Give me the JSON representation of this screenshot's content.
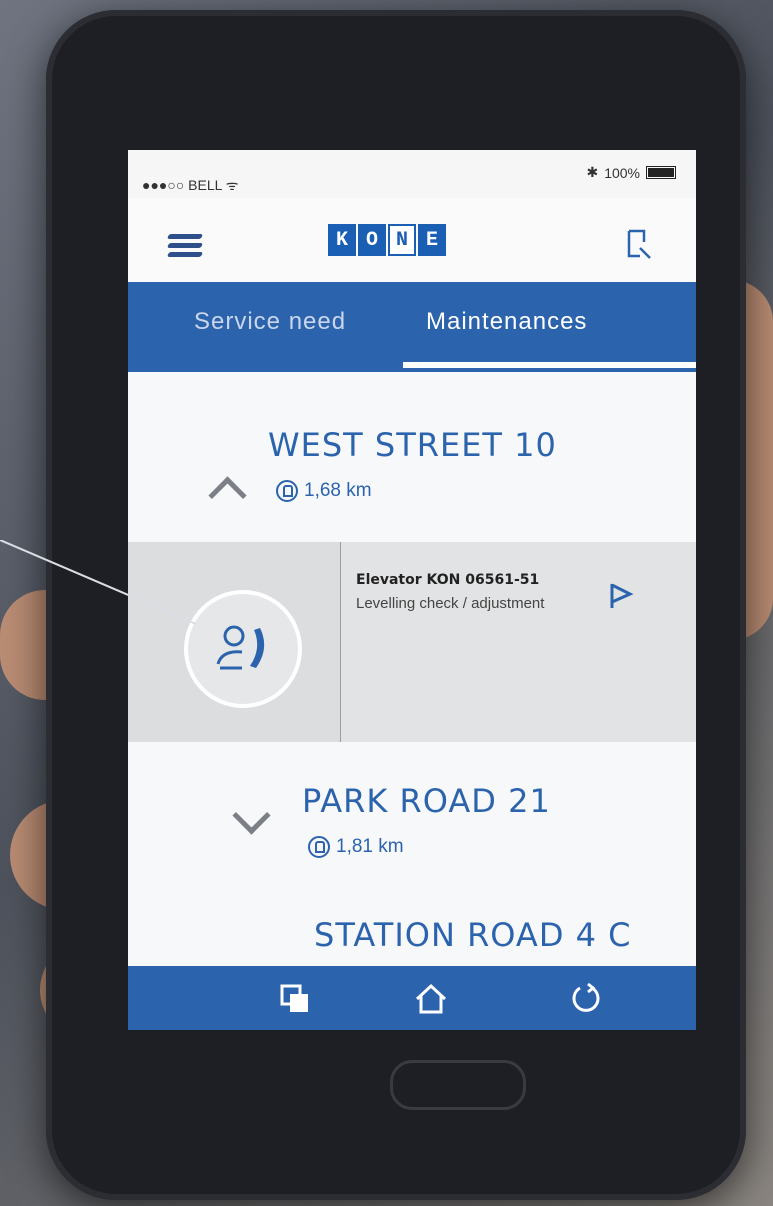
{
  "status_bar": {
    "carrier": "●●●○○ BELL ᯤ",
    "battery": "100%"
  },
  "header": {
    "logo_letters": [
      "K",
      "O",
      "N",
      "E"
    ]
  },
  "tabs": [
    {
      "label": "Service need",
      "active": false
    },
    {
      "label": "Maintenances",
      "active": true
    }
  ],
  "locations": [
    {
      "name": "WEST STREET 10",
      "distance": "1,68 km",
      "expanded": true
    },
    {
      "name": "PARK ROAD 21",
      "distance": "1,81 km",
      "expanded": false
    },
    {
      "name": "STATION ROAD 4 C",
      "distance": "",
      "expanded": false
    }
  ],
  "elevator": {
    "title": "Elevator KON 06561-51",
    "task": "Levelling check / adjustment"
  },
  "colors": {
    "brand": "#2c63ad",
    "background": "#f7f8fa"
  }
}
